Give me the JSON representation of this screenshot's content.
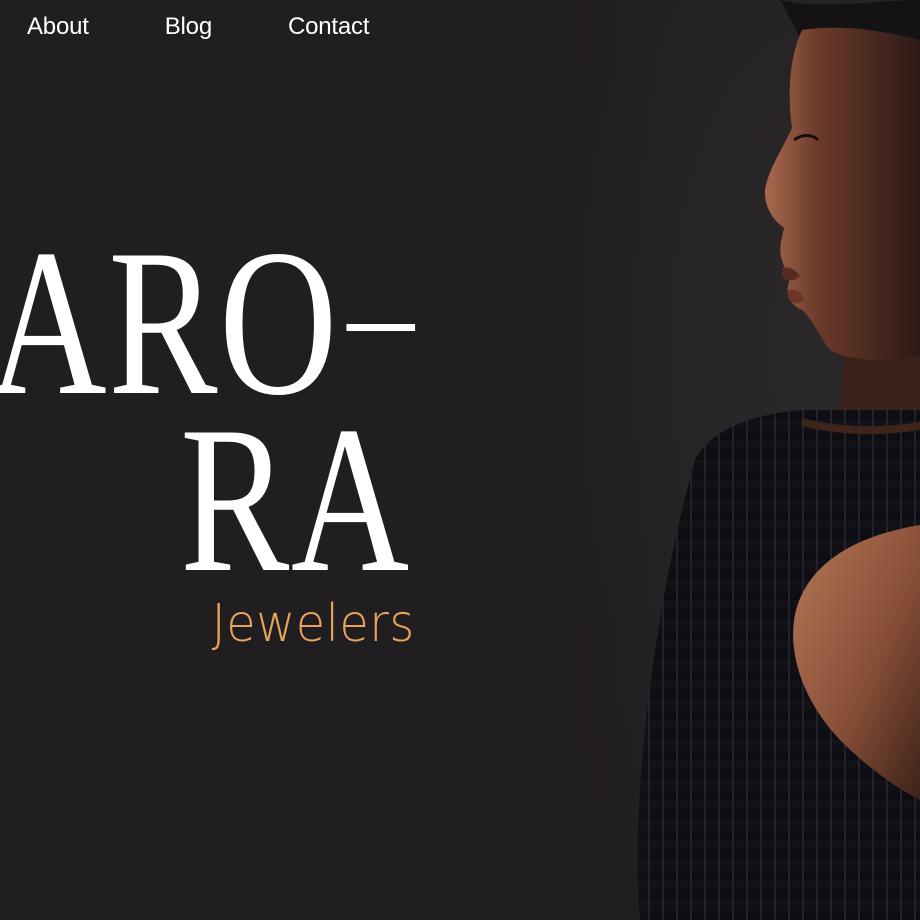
{
  "nav": {
    "items": [
      {
        "label": "About"
      },
      {
        "label": "Blog"
      },
      {
        "label": "Contact"
      }
    ]
  },
  "brand": {
    "line1": "ARO",
    "line2": "RA",
    "tagline": "Jewelers"
  },
  "colors": {
    "background": "#211e21",
    "text": "#ffffff",
    "accent": "#e8a55a"
  },
  "photo": {
    "subject": "side profile portrait of a woman in a black ribbed cut-out top"
  }
}
